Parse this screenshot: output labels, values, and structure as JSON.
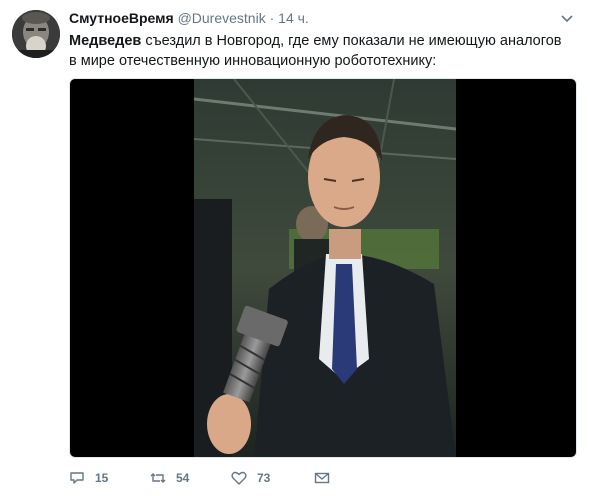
{
  "tweet": {
    "author_name": "СмутноеВремя",
    "author_handle": "@Durevestnik",
    "separator": "·",
    "time": "14 ч.",
    "text_bold": "Медведев",
    "text_rest": " съездил в Новгород, где ему показали не имеющую аналогов в мире отечественную инновационную робототехнику:",
    "replies": "15",
    "retweets": "54",
    "likes": "73"
  },
  "colors": {
    "text": "#14171a",
    "secondary": "#657786",
    "media_bg": "#000000"
  },
  "icons": [
    "avatar",
    "caret-down-icon",
    "reply-icon",
    "retweet-icon",
    "like-icon",
    "dm-icon"
  ]
}
